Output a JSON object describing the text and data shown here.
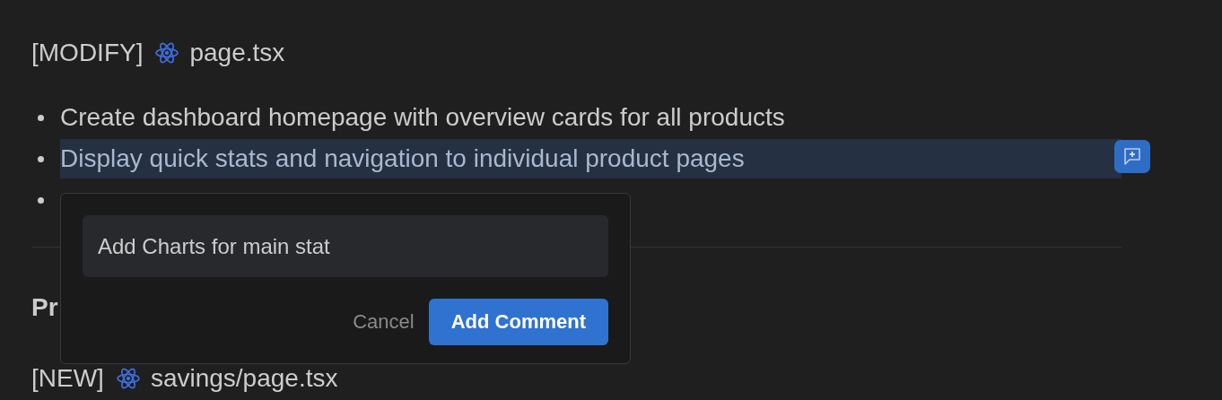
{
  "file_header": {
    "tag": "[MODIFY]",
    "filename": "page.tsx"
  },
  "bullets": [
    {
      "text": "Create dashboard homepage with overview cards for all products",
      "selected": false
    },
    {
      "text": "Display quick stats and navigation to individual product pages",
      "selected": true
    }
  ],
  "covered_bullet": true,
  "section_heading": "Pr",
  "file_header_2": {
    "tag": "[NEW]",
    "filename": "savings/page.tsx"
  },
  "comment_popup": {
    "value": "Add Charts for main stat",
    "buttons": [
      {
        "label": "Cancel",
        "kind": "secondary"
      },
      {
        "label": "Add Comment",
        "kind": "primary"
      }
    ]
  }
}
